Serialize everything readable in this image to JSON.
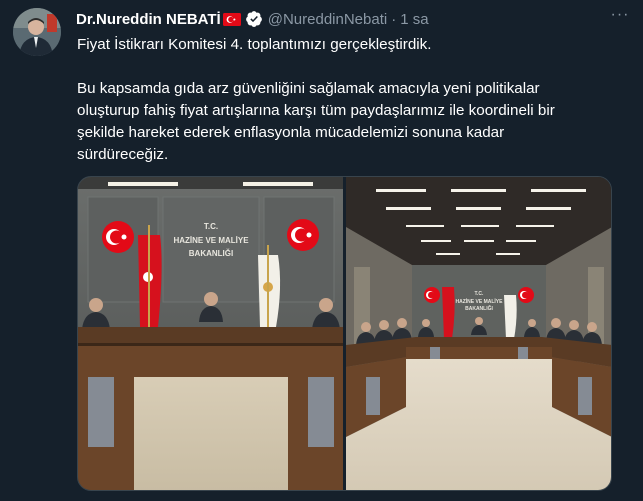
{
  "tweet": {
    "author_name": "Dr.Nureddin NEBATİ",
    "handle": "@NureddinNebati",
    "separator": "·",
    "time": "1 sa",
    "paragraphs": [
      "Fiyat İstikrarı Komitesi 4. toplantımızı gerçekleştirdik.",
      "Bu kapsamda gıda arz güvenliğini sağlamak amacıyla yeni politikalar\noluşturup fahiş fiyat artışlarına karşı tüm paydaşlarımız ile koordineli bir\nşekilde hareket ederek enflasyonla mücadelemizi sonuna kadar\nsürdüreceğiz."
    ],
    "icons": {
      "flag": "turkey-flag-icon",
      "verified": "verified-badge-icon",
      "more": "more-options-icon"
    },
    "more_label": "···"
  },
  "photos": [
    {
      "sign_line1": "T.C.",
      "sign_line2": "HAZİNE VE MALİYE",
      "sign_line3": "BAKANLIĞI"
    },
    {
      "sign_line1": "T.C.",
      "sign_line2": "HAZİNE VE MALİYE",
      "sign_line3": "BAKANLIĞI"
    }
  ],
  "colors": {
    "background": "#15202b",
    "text": "#ffffff",
    "secondary": "#8b98a5",
    "verified": "#ffffff",
    "flag_red": "#e30a17"
  }
}
